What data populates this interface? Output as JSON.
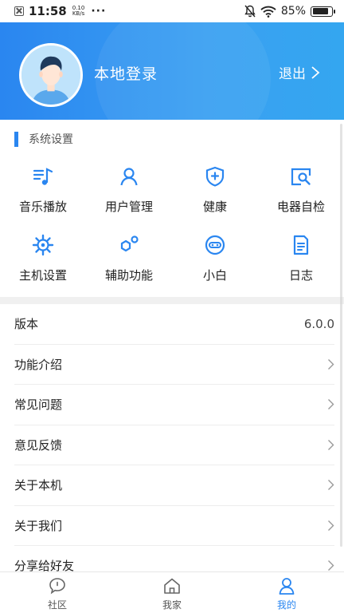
{
  "status_bar": {
    "time": "11:58",
    "net_speed_value": "0.10",
    "net_speed_unit": "KB/s",
    "dots": "···",
    "battery": "85%",
    "battery_level": 0.85
  },
  "header": {
    "user_name": "本地登录",
    "logout_label": "退出"
  },
  "settings": {
    "title": "系统设置",
    "items": [
      {
        "label": "音乐播放",
        "icon": "music-icon"
      },
      {
        "label": "用户管理",
        "icon": "user-icon"
      },
      {
        "label": "健康",
        "icon": "shield-plus-icon"
      },
      {
        "label": "电器自检",
        "icon": "device-search-icon"
      },
      {
        "label": "主机设置",
        "icon": "gear-icon"
      },
      {
        "label": "辅助功能",
        "icon": "nodes-icon"
      },
      {
        "label": "小白",
        "icon": "robot-face-icon"
      },
      {
        "label": "日志",
        "icon": "document-icon"
      }
    ]
  },
  "list": {
    "version_label": "版本",
    "version_value": "6.0.0",
    "items": [
      "功能介绍",
      "常见问题",
      "意见反馈",
      "关于本机",
      "关于我们",
      "分享给好友"
    ]
  },
  "tabbar": {
    "tabs": [
      {
        "label": "社区",
        "icon": "chat-bubble-icon"
      },
      {
        "label": "我家",
        "icon": "home-icon"
      },
      {
        "label": "我的",
        "icon": "person-icon"
      }
    ],
    "active": "我的"
  },
  "colors": {
    "accent": "#2a86f0",
    "header_gradient_end": "#34a6f0",
    "divider": "#f0f0f0"
  }
}
